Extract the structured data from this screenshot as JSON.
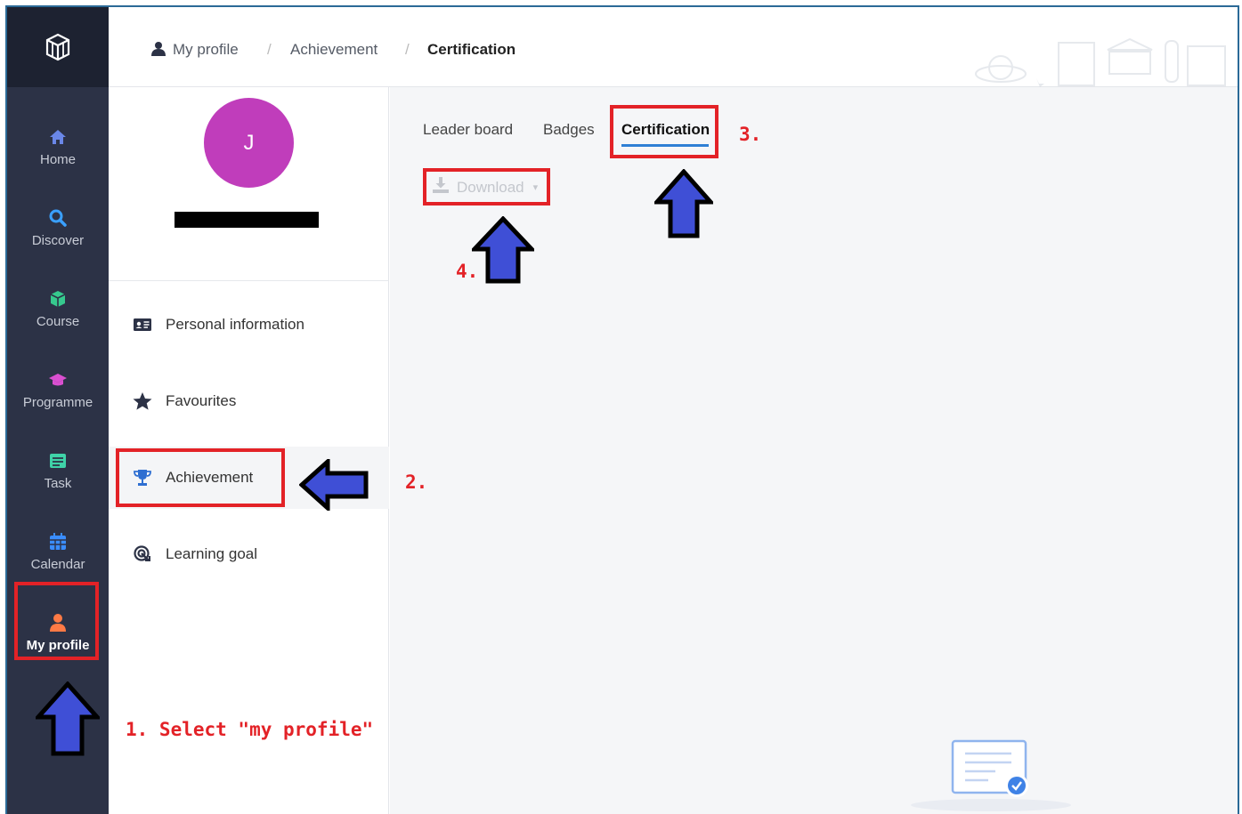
{
  "sidebar": {
    "items": [
      {
        "label": "Home",
        "icon": "home-icon"
      },
      {
        "label": "Discover",
        "icon": "search-icon"
      },
      {
        "label": "Course",
        "icon": "cube-icon"
      },
      {
        "label": "Programme",
        "icon": "graduation-cap-icon"
      },
      {
        "label": "Task",
        "icon": "task-list-icon"
      },
      {
        "label": "Calendar",
        "icon": "calendar-icon"
      },
      {
        "label": "My profile",
        "icon": "user-icon"
      }
    ]
  },
  "breadcrumb": {
    "items": [
      "My profile",
      "Achievement",
      "Certification"
    ],
    "separator": "/"
  },
  "profile": {
    "avatar_initial": "J"
  },
  "menu": {
    "items": [
      "Personal information",
      "Favourites",
      "Achievement",
      "Learning goal"
    ]
  },
  "tabs": [
    "Leader board",
    "Badges",
    "Certification"
  ],
  "download": {
    "label": "Download",
    "caret": "▾"
  },
  "annotations": {
    "step1": "1. Select \"my profile\"",
    "step2": "2.",
    "step3": "3.",
    "step4": "4."
  },
  "colors": {
    "sidebar": "#2c3246",
    "accent": "#2f7fd4",
    "avatar": "#c03dbb",
    "annotation_red": "#e32227",
    "annotation_arrow": "#3f4fd6"
  }
}
